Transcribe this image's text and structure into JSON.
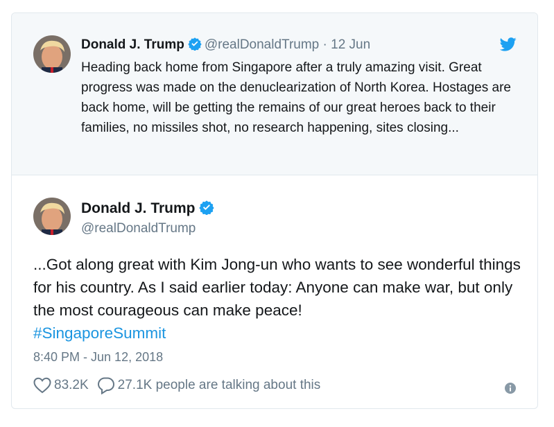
{
  "parent_tweet": {
    "author_name": "Donald J. Trump",
    "handle": "@realDonaldTrump",
    "separator": "·",
    "date": "12 Jun",
    "text": "Heading back home from Singapore after a truly amazing visit. Great progress was made on the denuclearization of North Korea. Hostages are back home, will be getting the remains of our great heroes back to their families, no missiles shot, no research happening, sites closing..."
  },
  "main_tweet": {
    "author_name": "Donald J. Trump",
    "handle": "@realDonaldTrump",
    "text": "...Got along great with Kim Jong-un who wants to see wonderful things for his country. As I said earlier today: Anyone can make war, but only the most courageous can make peace!",
    "hashtag": "#SingaporeSummit",
    "timestamp": "8:40 PM - Jun 12, 2018",
    "like_count": "83.2K",
    "reply_summary": "27.1K people are talking about this"
  },
  "icons": {
    "verified": "verified-badge-icon",
    "brand": "twitter-bird-icon",
    "like": "heart-icon",
    "reply": "speech-bubble-icon",
    "info": "info-icon"
  },
  "colors": {
    "brand_blue": "#1da1f2",
    "link_blue": "#1b95e0",
    "secondary_text": "#657786",
    "parent_background": "#f5f8fa",
    "border": "#e1e8ed"
  }
}
